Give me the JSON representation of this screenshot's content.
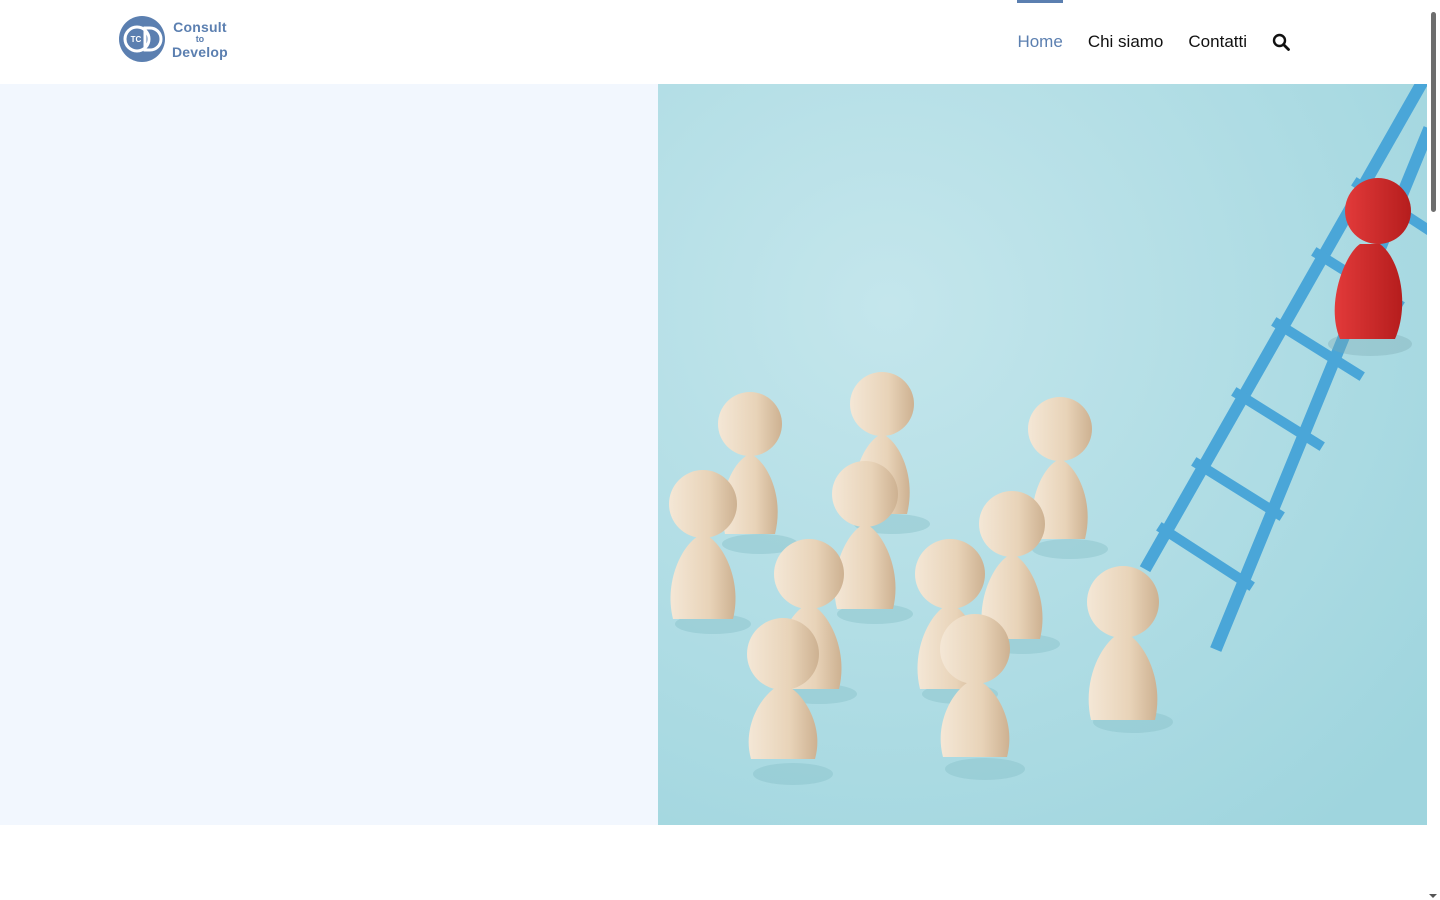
{
  "brand": {
    "line1": "Consult",
    "line2": "to",
    "line3": "Develop",
    "mark_text": "TC",
    "color": "#5b7fb0"
  },
  "nav": {
    "items": [
      {
        "label": "Home",
        "active": true
      },
      {
        "label": "Chi siamo",
        "active": false
      },
      {
        "label": "Contatti",
        "active": false
      }
    ],
    "search_icon": "search-icon"
  },
  "colors": {
    "accent": "#5b7fb0",
    "hero_left_bg": "#f2f7fe",
    "hero_right_bg": "#b6e0e7",
    "ladder": "#4aa6d8",
    "leader_figure": "#d92b2b",
    "figures": "#ead9c4"
  },
  "hero": {
    "image_alt": "wooden figures and a red figure climbing a blue ladder"
  }
}
